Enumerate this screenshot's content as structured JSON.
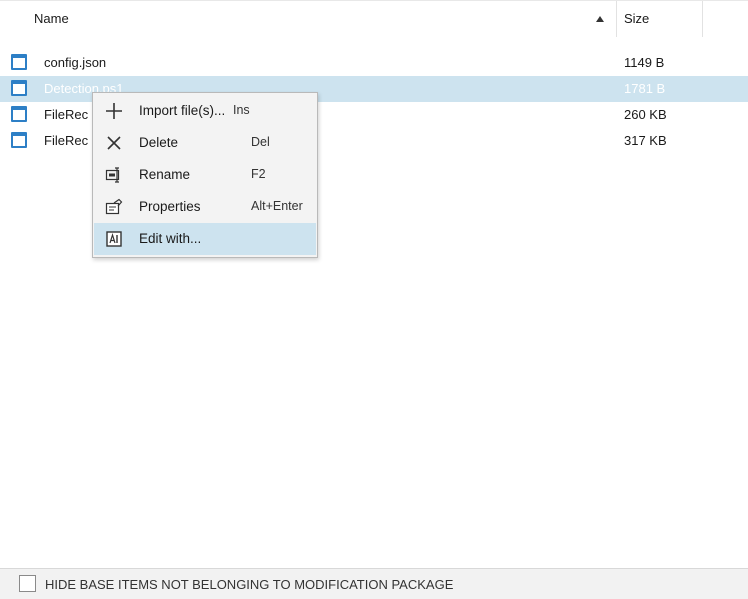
{
  "file_list": {
    "columns": {
      "name": "Name",
      "size": "Size"
    },
    "sort": {
      "column": "Name",
      "direction": "ascending"
    },
    "rows": [
      {
        "name": "config.json",
        "size": "1149 B",
        "selected": false
      },
      {
        "name": "Detection.ps1",
        "size": "1781 B",
        "selected": true
      },
      {
        "name": "FileRec",
        "size": "260 KB",
        "selected": false
      },
      {
        "name": "FileRec",
        "size": "317 KB",
        "selected": false
      }
    ]
  },
  "context_menu": {
    "items": [
      {
        "label": "Import file(s)...",
        "shortcut": "Ins",
        "icon": "plus-icon"
      },
      {
        "label": "Delete",
        "shortcut": "Del",
        "icon": "close-icon"
      },
      {
        "label": "Rename",
        "shortcut": "F2",
        "icon": "rename-icon"
      },
      {
        "label": "Properties",
        "shortcut": "Alt+Enter",
        "icon": "properties-icon"
      },
      {
        "label": "Edit with...",
        "shortcut": "",
        "icon": "edit-with-icon",
        "highlighted": true
      }
    ]
  },
  "footer": {
    "checkbox_label": "HIDE BASE ITEMS NOT BELONGING TO MODIFICATION PACKAGE",
    "checked": false
  },
  "colors": {
    "selection": "#cde3ef",
    "file_icon": "#2d7fc6",
    "menu_background": "#f3f3f3",
    "footer_background": "#f2f2f2"
  }
}
